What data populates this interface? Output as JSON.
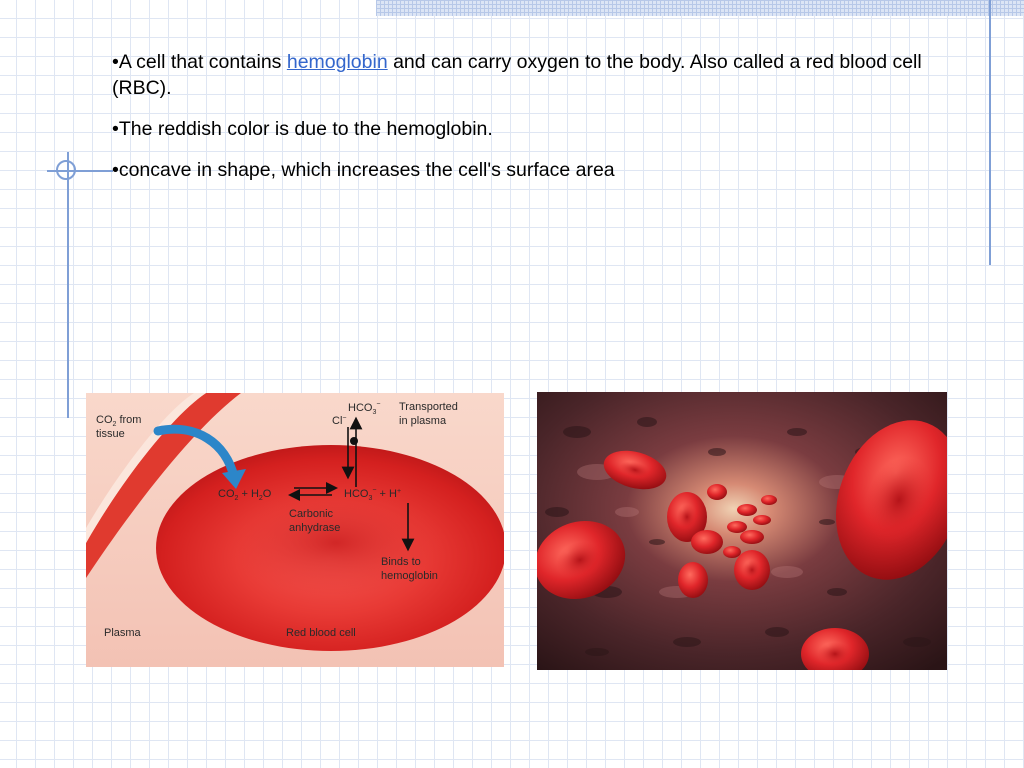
{
  "bullets": [
    {
      "prefix": "•A cell that contains ",
      "link": "hemoglobin",
      "suffix": " and can carry oxygen to the body. Also called a red blood cell (RBC)."
    },
    {
      "text": "•The reddish color is due to the hemoglobin."
    },
    {
      "text": "•concave in shape, which increases the cell's surface area"
    }
  ],
  "diagram": {
    "co2_from_tissue": [
      "CO",
      "2",
      " from",
      "tissue"
    ],
    "hco3_top": [
      "HCO",
      "3",
      "−"
    ],
    "cl": [
      "Cl",
      "−"
    ],
    "transported_in_plasma": [
      "Transported",
      "in plasma"
    ],
    "reaction_left": [
      "CO",
      "2",
      " + H",
      "2",
      "O"
    ],
    "reaction_right": [
      "HCO",
      "3",
      "−",
      " + H",
      "+"
    ],
    "carbonic_anhydrase": [
      "Carbonic",
      "anhydrase"
    ],
    "binds_to_hemoglobin": [
      "Binds to",
      "hemoglobin"
    ],
    "plasma": "Plasma",
    "red_blood_cell": "Red blood cell"
  },
  "colors": {
    "accent_rule": "#7f9fd6",
    "link": "#3366cc",
    "cell_red": "#e0262a"
  }
}
